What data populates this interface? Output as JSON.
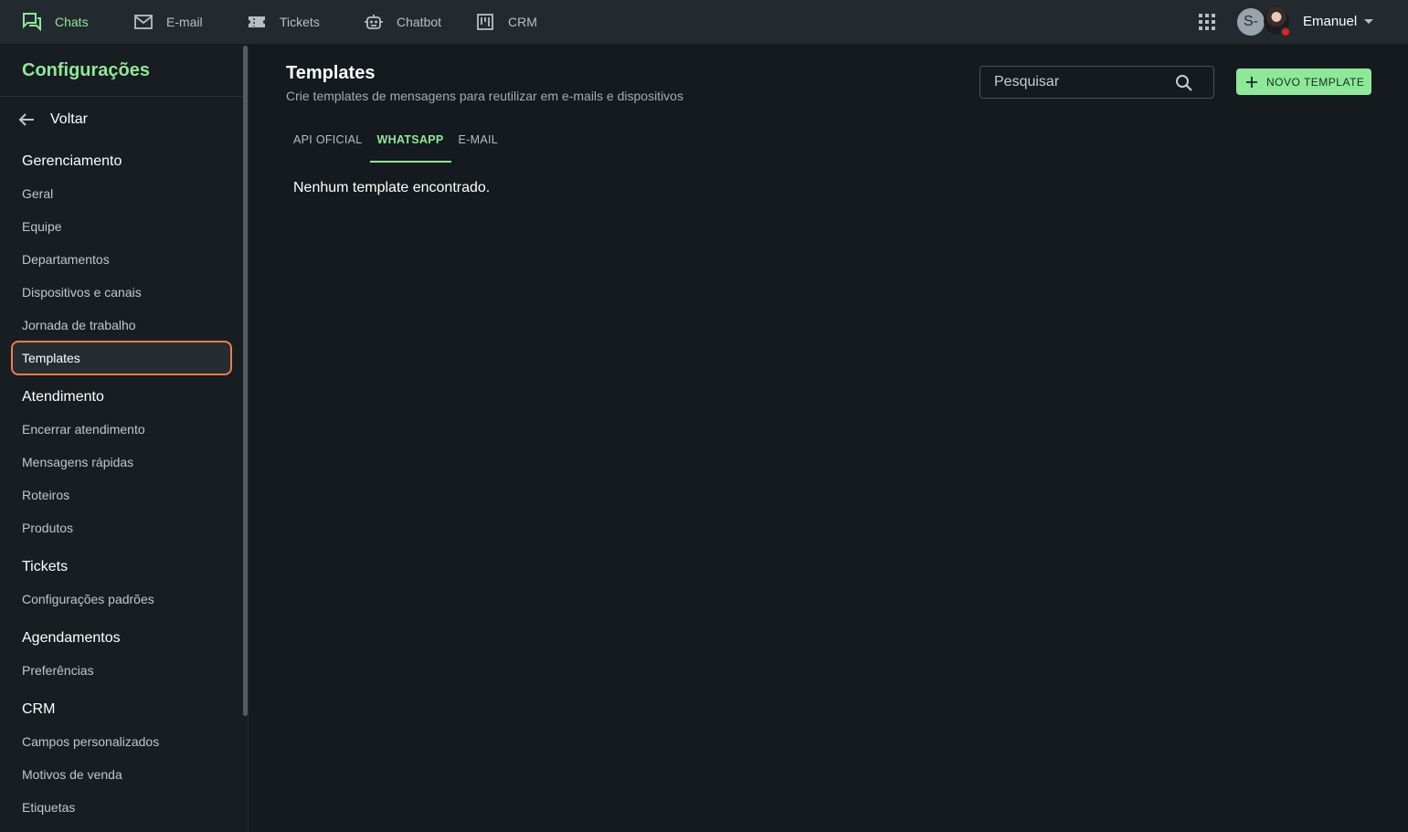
{
  "topnav": {
    "items": [
      {
        "label": "Chats",
        "icon": "chats-icon",
        "active": true
      },
      {
        "label": "E-mail",
        "icon": "mail-icon",
        "active": false
      },
      {
        "label": "Tickets",
        "icon": "ticket-icon",
        "active": false
      },
      {
        "label": "Chatbot",
        "icon": "robot-icon",
        "active": false
      },
      {
        "label": "CRM",
        "icon": "kanban-icon",
        "active": false
      }
    ],
    "avatar_initial": "S-",
    "user_name": "Emanuel"
  },
  "sidebar": {
    "title": "Configurações",
    "back_label": "Voltar",
    "sections": [
      {
        "title": "Gerenciamento",
        "items": [
          "Geral",
          "Equipe",
          "Departamentos",
          "Dispositivos e canais",
          "Jornada de trabalho",
          "Templates"
        ]
      },
      {
        "title": "Atendimento",
        "items": [
          "Encerrar atendimento",
          "Mensagens rápidas",
          "Roteiros",
          "Produtos"
        ]
      },
      {
        "title": "Tickets",
        "items": [
          "Configurações padrões"
        ]
      },
      {
        "title": "Agendamentos",
        "items": [
          "Preferências"
        ]
      },
      {
        "title": "CRM",
        "items": [
          "Campos personalizados",
          "Motivos de venda",
          "Etiquetas"
        ]
      }
    ],
    "selected_item": "Templates"
  },
  "main": {
    "title": "Templates",
    "subtitle": "Crie templates de mensagens para reutilizar em e-mails e dispositivos",
    "search_placeholder": "Pesquisar",
    "new_button_label": "NOVO TEMPLATE",
    "tabs": [
      "API OFICIAL",
      "WHATSAPP",
      "E-MAIL"
    ],
    "active_tab": "WHATSAPP",
    "empty_message": "Nenhum template encontrado."
  },
  "colors": {
    "accent": "#8ee89a",
    "selected_outline": "#f07b4f",
    "topbar_bg": "#232a2f",
    "page_bg": "#141a1e",
    "status_busy": "#e02424"
  }
}
